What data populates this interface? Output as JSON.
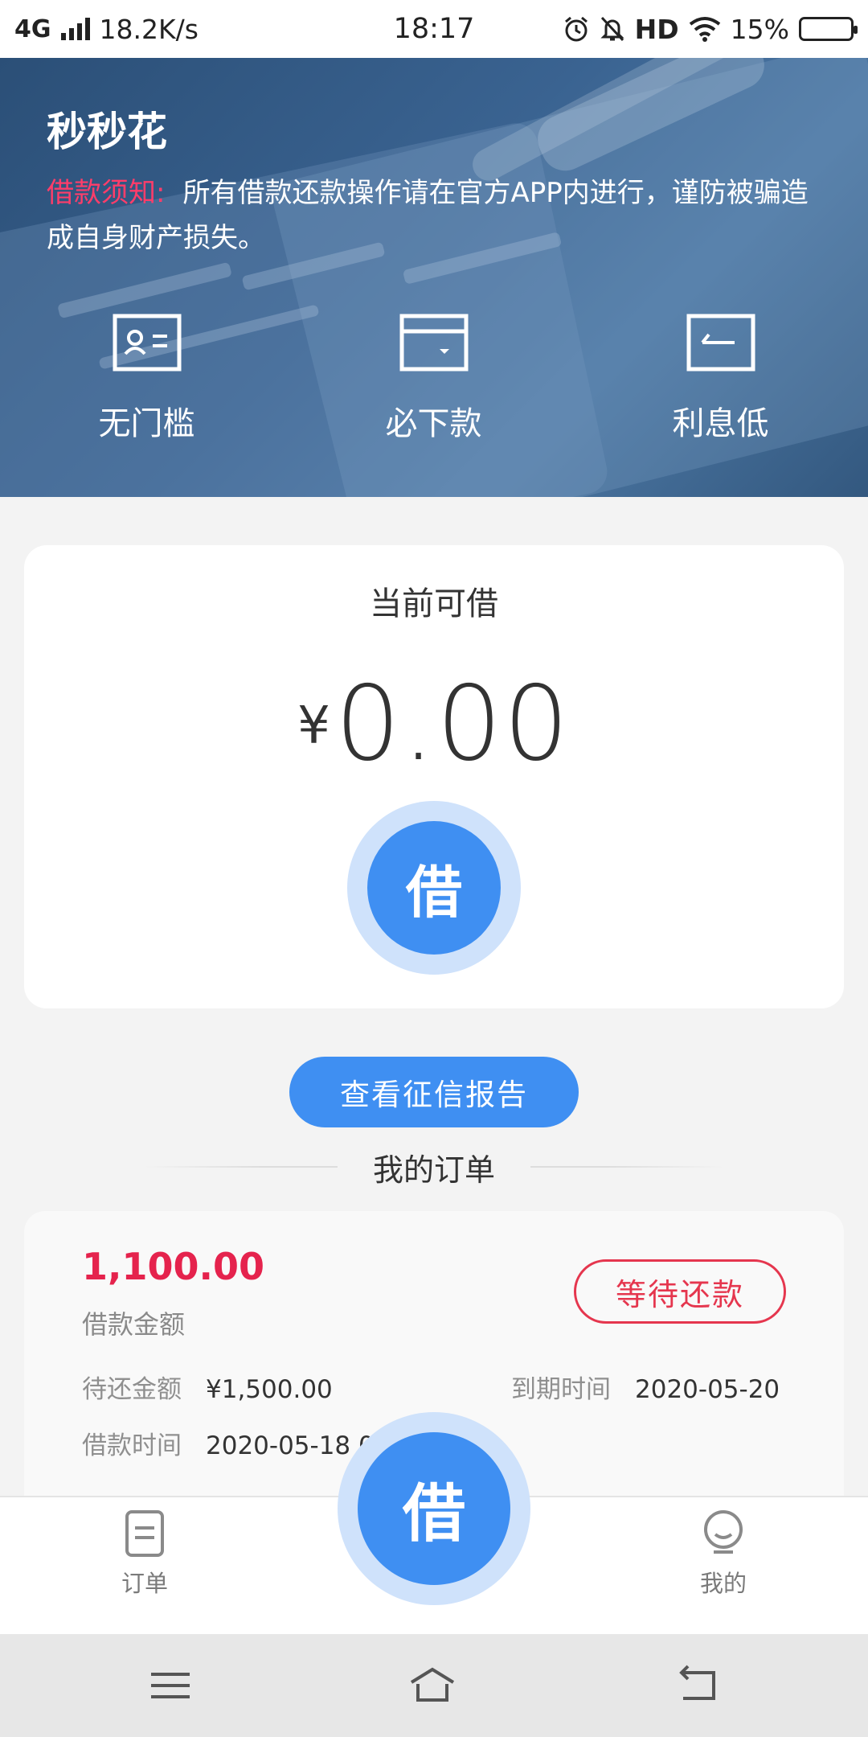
{
  "status_bar": {
    "network": "4G",
    "speed": "18.2K/s",
    "time": "18:17",
    "hd": "HD",
    "battery": "15%",
    "battery_level": 0.15
  },
  "hero": {
    "title": "秒秒花",
    "notice_label": "借款须知:",
    "notice_text": "所有借款还款操作请在官方APP内进行，谨防被骗造成自身财产损失。",
    "features": [
      {
        "label": "无门槛",
        "icon": "id-card-icon"
      },
      {
        "label": "必下款",
        "icon": "wallet-icon"
      },
      {
        "label": "利息低",
        "icon": "card-return-icon"
      }
    ]
  },
  "credit": {
    "title": "当前可借",
    "currency": "¥",
    "amount": "0.00",
    "borrow_label": "借"
  },
  "report_button": "查看征信报告",
  "orders_title": "我的订单",
  "order": {
    "amount": "1,100.00",
    "amount_label": "借款金额",
    "status": "等待还款",
    "due_amount_label": "待还金额",
    "due_amount": "¥1,500.00",
    "due_date_label": "到期时间",
    "due_date": "2020-05-20",
    "loan_time_label": "借款时间",
    "loan_time": "2020-05-18 0"
  },
  "tabbar": {
    "orders": "订单",
    "center": "借",
    "mine": "我的"
  },
  "colors": {
    "accent": "#3f8ff2",
    "accent_light": "#cfe2fb",
    "danger": "#e5234d",
    "hero": "#3a6391"
  }
}
